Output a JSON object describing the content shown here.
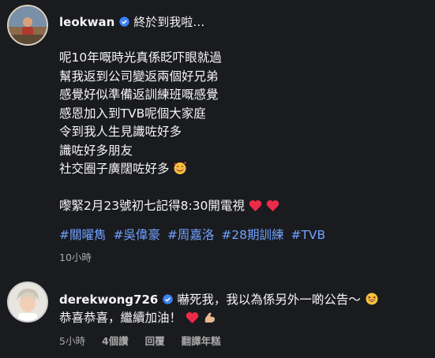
{
  "post": {
    "username": "leokwan",
    "headline": "終於到我啦…",
    "caption_lines": [
      "呢10年嘅時光真係眨吓眼就過",
      "幫我返到公司變返兩個好兄弟",
      "感覺好似準備返訓練班嘅感覺",
      "感恩加入到TVB呢個大家庭",
      "令到我人生見識咗好多",
      "識咗好多朋友",
      "社交圈子廣闊咗好多"
    ],
    "reminder": "嚟緊2月23號初七記得8:30開電視",
    "hashtags": [
      "#關曜雋",
      "#吳偉豪",
      "#周嘉洛",
      "#28期訓練",
      "#TVB"
    ],
    "time": "10小時"
  },
  "comment": {
    "username": "derekwong726",
    "text_line1": "嚇死我，我以為係另外一啲公告～",
    "text_line2": "恭喜恭喜，繼續加油！",
    "time": "5小時",
    "likes": "4個讚",
    "reply": "回覆",
    "translate": "翻譯年糕"
  },
  "colors": {
    "background": "#1a1b1f",
    "text": "#f5f5f5",
    "secondary": "#a8a8a8",
    "hashtag": "#6fa2ff",
    "verified": "#3b82f6"
  },
  "icons": [
    "verified-badge-icon",
    "smiling-face-with-hearts-emoji",
    "red-heart-emoji",
    "grinning-squinting-face-emoji",
    "flexed-biceps-emoji"
  ]
}
